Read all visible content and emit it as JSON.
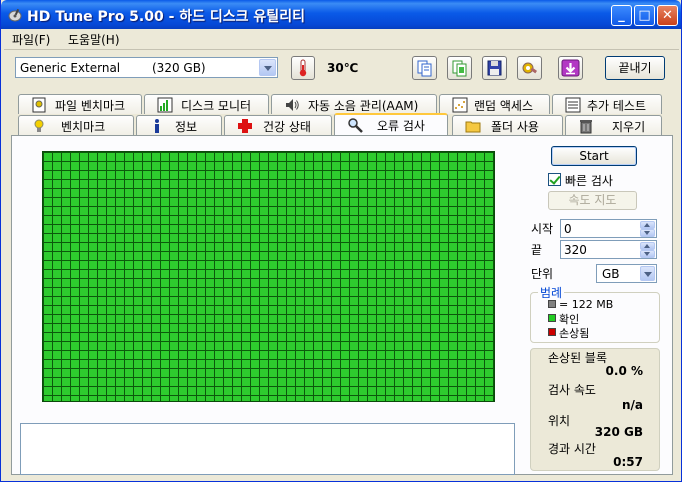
{
  "window": {
    "title": "HD Tune Pro 5.00 - 하드 디스크 유틸리티",
    "min_glyph": "_",
    "max_glyph": "□",
    "close_glyph": "✕"
  },
  "menu": {
    "file": "파일(F)",
    "help": "도움말(H)"
  },
  "toolbar": {
    "drive_name": "Generic External",
    "drive_size": "(320 GB)",
    "temperature": "30℃",
    "exit_label": "끝내기",
    "icons": [
      "copy-text-icon",
      "copy-image-icon",
      "save-icon",
      "options-icon",
      "download-icon"
    ]
  },
  "tabs_top": [
    {
      "label": "파일 벤치마크",
      "icon": "file-benchmark-icon"
    },
    {
      "label": "디스크 모니터",
      "icon": "disk-monitor-icon"
    },
    {
      "label": "자동 소음 관리(AAM)",
      "icon": "speaker-icon"
    },
    {
      "label": "랜덤 액세스",
      "icon": "random-access-icon"
    },
    {
      "label": "추가 테스트",
      "icon": "extra-tests-icon"
    }
  ],
  "tabs_bottom": [
    {
      "label": "벤치마크",
      "icon": "benchmark-icon"
    },
    {
      "label": "정보",
      "icon": "info-icon"
    },
    {
      "label": "건강 상태",
      "icon": "health-icon"
    },
    {
      "label": "오류 검사",
      "icon": "error-scan-icon",
      "active": true
    },
    {
      "label": "폴더 사용",
      "icon": "folder-usage-icon"
    },
    {
      "label": "지우기",
      "icon": "erase-icon"
    }
  ],
  "scan": {
    "start_label": "Start",
    "quick_scan_label": "빠른 검사",
    "quick_scan_checked": true,
    "speed_map_label": "속도 지도",
    "start_field_label": "시작",
    "start_value": "0",
    "end_field_label": "끝",
    "end_value": "320",
    "unit_label": "단위",
    "unit_value": "GB"
  },
  "legend": {
    "title": "범례",
    "block_size": "= 122 MB",
    "ok_label": "확인",
    "damaged_label": "손상됨",
    "colors": {
      "block": "#808080",
      "ok": "#22cc22",
      "damaged": "#cc0000"
    }
  },
  "stats": {
    "damaged_blocks_label": "손상된 블록",
    "damaged_blocks_value": "0.0 %",
    "scan_speed_label": "검사 속도",
    "scan_speed_value": "n/a",
    "position_label": "위치",
    "position_value": "320 GB",
    "elapsed_label": "경과 시간",
    "elapsed_value": "0:57"
  },
  "grid": {
    "status": "all-ok",
    "color_ok": "#2ecc2e"
  }
}
